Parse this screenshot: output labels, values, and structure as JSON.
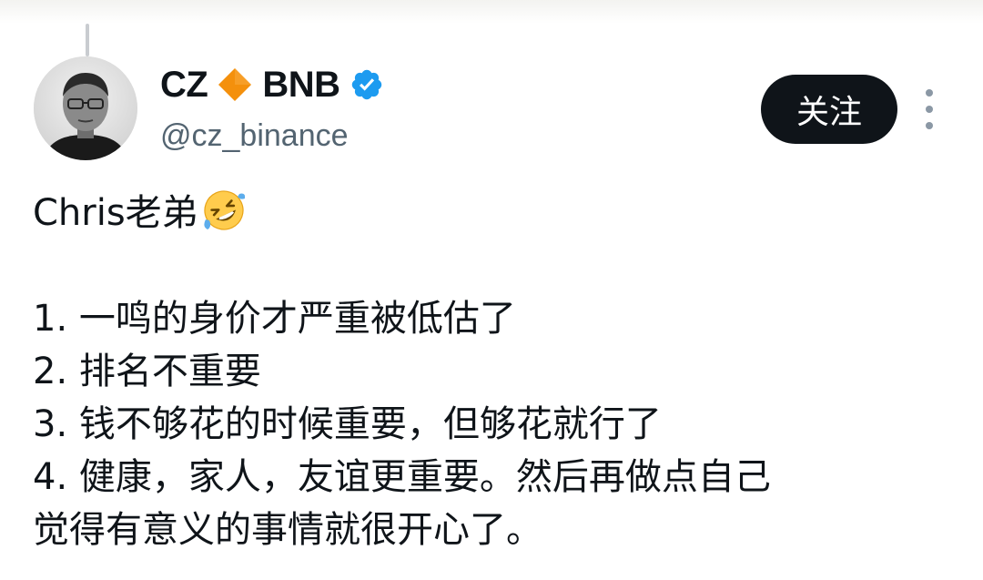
{
  "author": {
    "display_name_part1": "CZ",
    "display_name_part2": "BNB",
    "handle": "@cz_binance",
    "diamond_icon": "orange-diamond-icon",
    "verified_icon": "verified-badge-icon",
    "verified_color": "#1d9bf0",
    "diamond_color": "#f4900c"
  },
  "actions": {
    "follow_label": "关注",
    "more_icon": "more-options-icon"
  },
  "tweet": {
    "greeting": "Chris老弟",
    "greeting_emoji": "rolling-on-the-floor-laughing-emoji",
    "lines": [
      "1. 一鸣的身价才严重被低估了",
      "2. 排名不重要",
      "3. 钱不够花的时候重要，但够花就行了",
      "4. 健康，家人，友谊更重要。然后再做点自己",
      "觉得有意义的事情就很开心了。"
    ]
  }
}
